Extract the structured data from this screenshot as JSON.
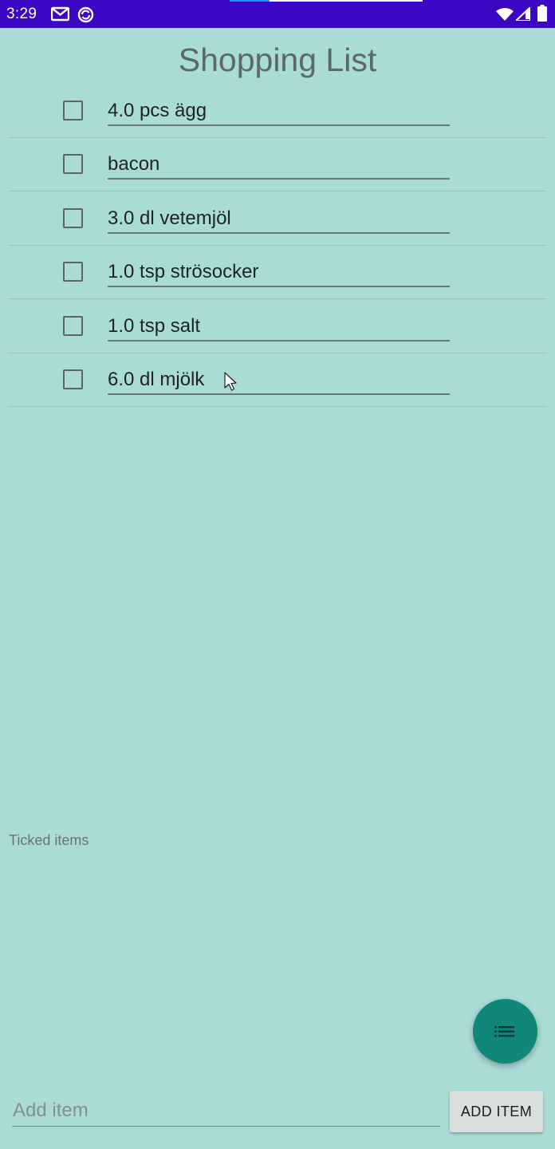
{
  "status_bar": {
    "time": "3:29",
    "icons": [
      "gmail-icon",
      "sync-icon",
      "wifi-icon",
      "signal-icon",
      "battery-icon"
    ]
  },
  "title": "Shopping List",
  "items": [
    {
      "label": "4.0 pcs ägg",
      "checked": false
    },
    {
      "label": "bacon",
      "checked": false
    },
    {
      "label": "3.0 dl vetemjöl",
      "checked": false
    },
    {
      "label": "1.0 tsp strösocker",
      "checked": false
    },
    {
      "label": "1.0 tsp salt",
      "checked": false
    },
    {
      "label": "6.0 dl mjölk",
      "checked": false
    }
  ],
  "ticked_section": {
    "label": "Ticked items"
  },
  "fab": {
    "icon": "list-icon"
  },
  "add_bar": {
    "placeholder": "Add item",
    "button_label": "ADD ITEM"
  },
  "colors": {
    "status_bar": "#3a07c4",
    "background": "#aadcd7",
    "fab": "#0f887a",
    "button": "#dadfde"
  }
}
